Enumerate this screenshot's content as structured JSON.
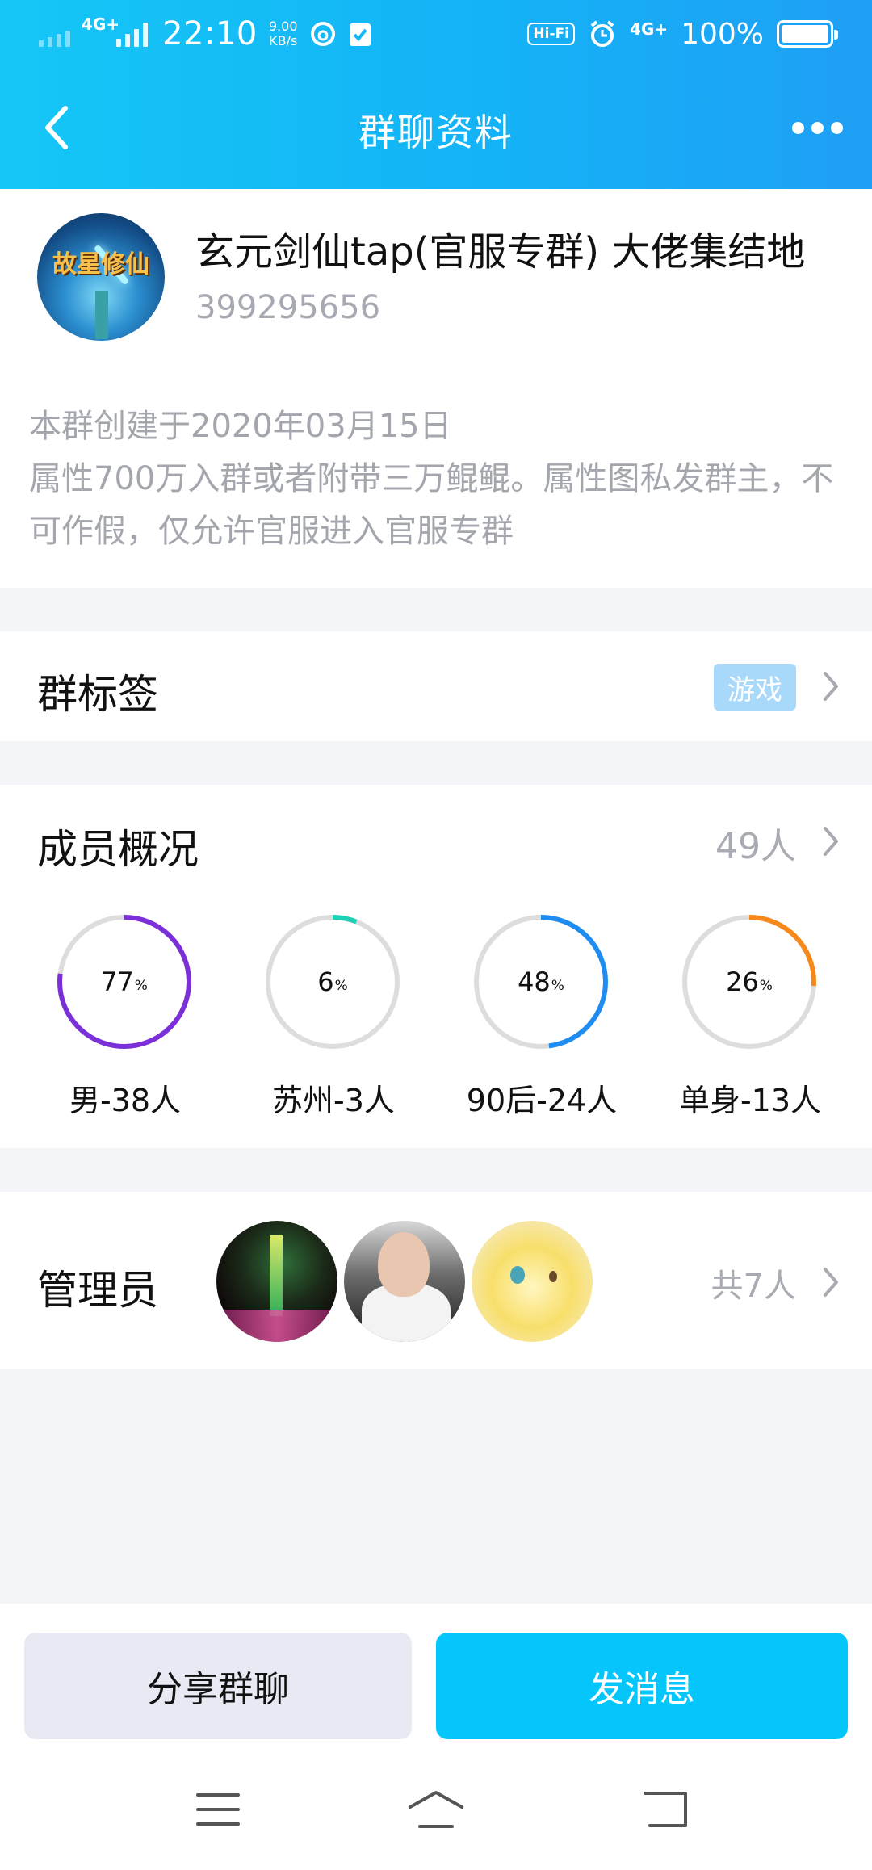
{
  "status_bar": {
    "net1": "4G+",
    "net2": "4G+",
    "time": "22:10",
    "speed_value": "9.00",
    "speed_unit": "KB/s",
    "hifi": "Hi-Fi",
    "battery_percent": "100%",
    "icons": [
      "signal-icon",
      "netease-music-icon",
      "task-check-icon",
      "alarm-icon",
      "battery-icon"
    ]
  },
  "header": {
    "title": "群聊资料",
    "back_icon": "chevron-left-icon",
    "more_icon": "more-dots-icon"
  },
  "group": {
    "name": "玄元剑仙tap(官服专群) 大佬集结地",
    "id": "399295656",
    "avatar_text": "故星修仙",
    "description_line1": "本群创建于2020年03月15日",
    "description_line2": "属性700万入群或者附带三万鲲鲲。属性图私发群主，不可作假，仅允许官服进入官服专群"
  },
  "tags": {
    "title": "群标签",
    "badge": "游戏"
  },
  "members": {
    "title": "成员概况",
    "count": "49人",
    "stats": [
      {
        "value": "77",
        "unit": "%",
        "label": "男-38人",
        "fraction": 0.77,
        "color": "#7a2fd8"
      },
      {
        "value": "6",
        "unit": "%",
        "label": "苏州-3人",
        "fraction": 0.06,
        "color": "#20d0b5"
      },
      {
        "value": "48",
        "unit": "%",
        "label": "90后-24人",
        "fraction": 0.48,
        "color": "#1e8cf0"
      },
      {
        "value": "26",
        "unit": "%",
        "label": "单身-13人",
        "fraction": 0.26,
        "color": "#f7891b"
      }
    ],
    "ring_track_color": "#dddddd"
  },
  "admins": {
    "title": "管理员",
    "total": "共7人"
  },
  "actions": {
    "share": "分享群聊",
    "send": "发消息"
  },
  "system_nav": {
    "icons": [
      "menu-icon",
      "home-icon",
      "back-icon"
    ]
  }
}
